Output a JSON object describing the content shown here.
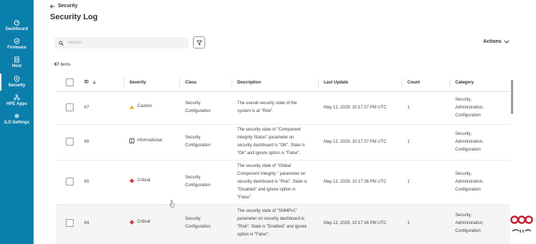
{
  "sidebar": {
    "items": [
      {
        "label": "Dashboard",
        "icon": "dashboard-icon"
      },
      {
        "label": "Firmware",
        "icon": "firmware-icon"
      },
      {
        "label": "Host",
        "icon": "host-icon"
      },
      {
        "label": "Security",
        "icon": "shield-icon"
      },
      {
        "label": "HPE Apps",
        "icon": "apps-icon"
      },
      {
        "label": "iLO Settings",
        "icon": "gear-icon"
      }
    ],
    "active": "Security",
    "background": "#0b7fab"
  },
  "header": {
    "back_label": "Security",
    "title": "Security Log"
  },
  "search": {
    "placeholder": "Search"
  },
  "actions_label": "Actions",
  "item_count": {
    "number": "67",
    "suffix": "items"
  },
  "table": {
    "columns": [
      "ID",
      "Severity",
      "Class",
      "Description",
      "Last Update",
      "Count",
      "Category"
    ],
    "rows": [
      {
        "id": "67",
        "severity": "Caution",
        "severity_icon": "warning-triangle-icon",
        "class": [
          "Security",
          "Configuration"
        ],
        "description": [
          "The overall security state of the",
          "system is at \"Risk\"."
        ],
        "last_update": "May 12, 2029, 10:17:37 PM UTC",
        "count": "1",
        "category": [
          "Security,",
          "Administration,",
          "Configuration"
        ]
      },
      {
        "id": "66",
        "severity": "Informational",
        "severity_icon": "info-square-icon",
        "class": [
          "Security",
          "Configuration"
        ],
        "description": [
          "The security state of \"Component",
          "Integrity Status\" parameter on",
          "security dashboard is \"OK\". State is",
          "\"Ok\" and ignore option is \"False\"."
        ],
        "last_update": "May 12, 2029, 10:17:37 PM UTC",
        "count": "1",
        "category": [
          "Security,",
          "Administration,",
          "Configuration"
        ]
      },
      {
        "id": "65",
        "severity": "Critical",
        "severity_icon": "critical-diamond-icon",
        "class": [
          "Security",
          "Configuration"
        ],
        "description": [
          "The security state of \"Global",
          "Component Integrity \" parameter on",
          "security dashboard is \"Risk\". State is",
          "\"Disabled\" and ignore option is",
          "\"False\"."
        ],
        "last_update": "May 12, 2029, 10:17:36 PM UTC",
        "count": "1",
        "category": [
          "Security,",
          "Administration,",
          "Configuration"
        ]
      },
      {
        "id": "64",
        "severity": "Critical",
        "severity_icon": "critical-diamond-icon",
        "class": [
          "Security",
          "Configuration"
        ],
        "description": [
          "The security state of \"SNMPv1\"",
          "parameter on security dashboard is",
          "\"Risk\". State is \"Enabled\" and ignore",
          "option is \"False\"."
        ],
        "last_update": "May 12, 2029, 10:17:36 PM UTC",
        "count": "1",
        "category": [
          "Security,",
          "Administration,",
          "Configuration"
        ]
      }
    ]
  },
  "colors": {
    "caution": "#f2b01e",
    "critical": "#d8364a",
    "accent": "#0b7fab",
    "watermark": "#c0202e"
  }
}
